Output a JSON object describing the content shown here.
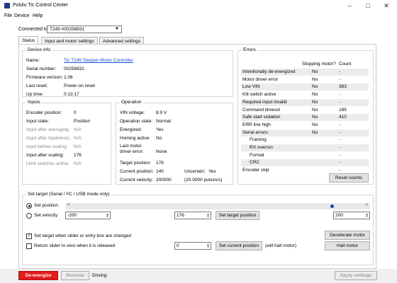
{
  "window": {
    "title": "Pololu Tic Control Center"
  },
  "menu": {
    "file": "File",
    "device": "Device",
    "help": "Help"
  },
  "connection": {
    "label": "Connected to:",
    "value": "T249 #00258931"
  },
  "tabs": [
    {
      "label": "Status"
    },
    {
      "label": "Input and motor settings"
    },
    {
      "label": "Advanced settings"
    }
  ],
  "device_info": {
    "title": "Device info",
    "name_label": "Name:",
    "name": "Tic T249 Stepper Motor Controller",
    "serial_label": "Serial number:",
    "serial": "00258931",
    "firmware_label": "Firmware version:",
    "firmware": "1.06",
    "last_reset_label": "Last reset:",
    "last_reset": "Power-on reset",
    "uptime_label": "Up time:",
    "uptime": "0:13:17"
  },
  "inputs": {
    "title": "Inputs",
    "encoder_label": "Encoder position:",
    "encoder": "0",
    "input_state_label": "Input state:",
    "input_state": "Position",
    "after_avg_label": "Input after averaging:",
    "after_avg": "N/A",
    "after_hyst_label": "Input after hysteresis:",
    "after_hyst": "N/A",
    "before_scaling_label": "Input before scaling:",
    "before_scaling": "N/A",
    "after_scaling_label": "Input after scaling:",
    "after_scaling": "176",
    "limit_label": "Limit switches active:",
    "limit": "N/A"
  },
  "operation": {
    "title": "Operation",
    "vin_label": "VIN voltage:",
    "vin": "8.9 V",
    "op_state_label": "Operation state:",
    "op_state": "Normal",
    "energized_label": "Energized:",
    "energized": "Yes",
    "homing_label": "Homing active:",
    "homing": "No",
    "last_motor_label1": "Last motor",
    "last_motor_label2": "driver error:",
    "last_motor": "None",
    "target_pos_label": "Target position:",
    "target_pos": "176",
    "current_pos_label": "Current position:",
    "current_pos": "140",
    "uncertain_label": "Uncertain:",
    "uncertain": "Yes",
    "current_vel_label": "Current velocity:",
    "current_vel": "200000",
    "current_vel_pps": "(20.0000 pulses/s)"
  },
  "errors": {
    "title": "Errors",
    "col_stopping": "Stopping motor?",
    "col_count": "Count",
    "rows": [
      {
        "name": "Intentionally de-energized",
        "stopping": "No",
        "count": "-"
      },
      {
        "name": "Motor driver error",
        "stopping": "No",
        "count": "-"
      },
      {
        "name": "Low VIN",
        "stopping": "No",
        "count": "383"
      },
      {
        "name": "Kill switch active",
        "stopping": "No",
        "count": "-"
      },
      {
        "name": "Required input invalid",
        "stopping": "No",
        "count": "-"
      },
      {
        "name": "Command timeout",
        "stopping": "No",
        "count": "185"
      },
      {
        "name": "Safe start violation",
        "stopping": "No",
        "count": "410"
      },
      {
        "name": "ERR line high",
        "stopping": "No",
        "count": "-"
      },
      {
        "name": "Serial errors:",
        "stopping": "No",
        "count": "-"
      },
      {
        "name": "Framing",
        "stopping": "",
        "count": "-"
      },
      {
        "name": "RX overrun",
        "stopping": "",
        "count": "-"
      },
      {
        "name": "Format",
        "stopping": "",
        "count": "-"
      },
      {
        "name": "CRC",
        "stopping": "",
        "count": "-"
      },
      {
        "name": "Encoder skip",
        "stopping": "",
        "count": "-"
      }
    ],
    "reset_button": "Reset counts"
  },
  "set_target": {
    "title": "Set target (Serial / I²C / USB mode only)",
    "set_position_label": "Set position",
    "set_velocity_label": "Set velocity",
    "velocity_min": "-200",
    "velocity_max": "200",
    "target_value": "176",
    "set_target_button": "Set target position",
    "slider_position_percent": 87,
    "set_when_changed_label": "Set target when slider or entry box are changed",
    "set_when_changed_checked": true,
    "return_zero_label": "Return slider to zero when it is released",
    "return_zero_checked": false,
    "current_position_value": "0",
    "set_current_button": "Set current position",
    "will_halt": "(will halt motor)",
    "decelerate_button": "Decelerate motor",
    "halt_button": "Halt motor"
  },
  "status_bar": {
    "deenergize": "De-energize",
    "resume": "Resume",
    "status": "Driving.",
    "apply": "Apply settings"
  },
  "colors": {
    "deenergize_bg": "#e31c1c",
    "link": "#1a4fd6",
    "slider_thumb": "#1d3fbf"
  }
}
